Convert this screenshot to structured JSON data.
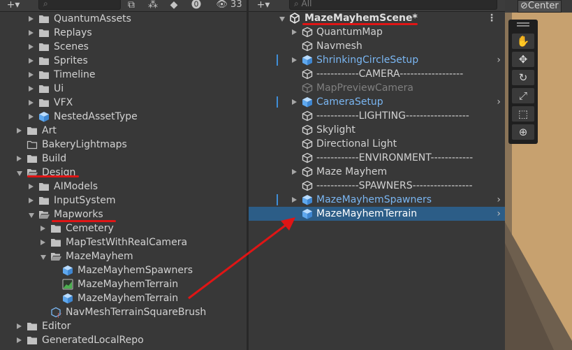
{
  "project": {
    "search_placeholder": "",
    "badge_count": "33",
    "items": [
      {
        "label": "QuantumAssets",
        "icon": "folder",
        "expand": "right",
        "indent": 1
      },
      {
        "label": "Replays",
        "icon": "folder",
        "expand": "right",
        "indent": 1
      },
      {
        "label": "Scenes",
        "icon": "folder",
        "expand": "right",
        "indent": 1
      },
      {
        "label": "Sprites",
        "icon": "folder",
        "expand": "right",
        "indent": 1
      },
      {
        "label": "Timeline",
        "icon": "folder",
        "expand": "right",
        "indent": 1
      },
      {
        "label": "Ui",
        "icon": "folder",
        "expand": "right",
        "indent": 1
      },
      {
        "label": "VFX",
        "icon": "folder",
        "expand": "right",
        "indent": 1
      },
      {
        "label": "NestedAssetType",
        "icon": "prefab",
        "expand": "right",
        "indent": 1
      },
      {
        "label": "Art",
        "icon": "folder",
        "expand": "right",
        "indent": 0
      },
      {
        "label": "BakeryLightmaps",
        "icon": "folder-empty",
        "expand": "none",
        "indent": 0
      },
      {
        "label": "Build",
        "icon": "folder",
        "expand": "right",
        "indent": 0
      },
      {
        "label": "Design",
        "icon": "folder-open",
        "expand": "down",
        "indent": 0
      },
      {
        "label": "AIModels",
        "icon": "folder",
        "expand": "right",
        "indent": 1
      },
      {
        "label": "InputSystem",
        "icon": "folder",
        "expand": "right",
        "indent": 1
      },
      {
        "label": "Mapworks",
        "icon": "folder-open",
        "expand": "down",
        "indent": 1
      },
      {
        "label": "Cemetery",
        "icon": "folder",
        "expand": "right",
        "indent": 2
      },
      {
        "label": "MapTestWithRealCamera",
        "icon": "folder",
        "expand": "right",
        "indent": 2
      },
      {
        "label": "MazeMayhem",
        "icon": "folder-open",
        "expand": "down",
        "indent": 2
      },
      {
        "label": "MazeMayhemSpawners",
        "icon": "prefab",
        "expand": "none",
        "indent": 3
      },
      {
        "label": "MazeMayhemTerrain",
        "icon": "terrain",
        "expand": "none",
        "indent": 3
      },
      {
        "label": "MazeMayhemTerrain",
        "icon": "prefab",
        "expand": "none",
        "indent": 3
      },
      {
        "label": "NavMeshTerrainSquareBrush",
        "icon": "script-asset",
        "expand": "none",
        "indent": 2
      },
      {
        "label": "Editor",
        "icon": "folder",
        "expand": "right",
        "indent": 0
      },
      {
        "label": "GeneratedLocalRepo",
        "icon": "folder",
        "expand": "right",
        "indent": 0
      }
    ]
  },
  "hierarchy": {
    "search_placeholder": "All",
    "scene_name": "MazeMayhemScene*",
    "items": [
      {
        "label": "QuantumMap",
        "icon": "gameobject",
        "expand": "right",
        "style": "normal",
        "chevron": false,
        "prefab_bar": false
      },
      {
        "label": "Navmesh",
        "icon": "gameobject",
        "expand": "none",
        "style": "normal",
        "chevron": false,
        "prefab_bar": false
      },
      {
        "label": "ShrinkingCircleSetup",
        "icon": "prefab",
        "expand": "right",
        "style": "blue",
        "chevron": true,
        "prefab_bar": true
      },
      {
        "label": "------------CAMERA------------------",
        "icon": "gameobject",
        "expand": "none",
        "style": "normal",
        "chevron": false,
        "prefab_bar": false
      },
      {
        "label": "MapPreviewCamera",
        "icon": "gameobject-dim",
        "expand": "none",
        "style": "dim",
        "chevron": false,
        "prefab_bar": false
      },
      {
        "label": "CameraSetup",
        "icon": "prefab",
        "expand": "right",
        "style": "blue",
        "chevron": true,
        "prefab_bar": true
      },
      {
        "label": "------------LIGHTING------------------",
        "icon": "gameobject",
        "expand": "none",
        "style": "normal",
        "chevron": false,
        "prefab_bar": false
      },
      {
        "label": "Skylight",
        "icon": "gameobject",
        "expand": "none",
        "style": "normal",
        "chevron": false,
        "prefab_bar": false
      },
      {
        "label": "Directional Light",
        "icon": "gameobject",
        "expand": "none",
        "style": "normal",
        "chevron": false,
        "prefab_bar": false
      },
      {
        "label": "------------ENVIRONMENT------------",
        "icon": "gameobject",
        "expand": "none",
        "style": "normal",
        "chevron": false,
        "prefab_bar": false
      },
      {
        "label": "Maze Mayhem",
        "icon": "gameobject",
        "expand": "right",
        "style": "normal",
        "chevron": false,
        "prefab_bar": false
      },
      {
        "label": "------------SPAWNERS-----------------",
        "icon": "gameobject",
        "expand": "none",
        "style": "normal",
        "chevron": false,
        "prefab_bar": false
      },
      {
        "label": "MazeMayhemSpawners",
        "icon": "prefab",
        "expand": "right",
        "style": "blue",
        "chevron": true,
        "prefab_bar": true
      },
      {
        "label": "MazeMayhemTerrain",
        "icon": "prefab",
        "expand": "none",
        "style": "selected",
        "chevron": true,
        "prefab_bar": false
      }
    ]
  },
  "scene": {
    "pivot_label": "Center",
    "tools": [
      "hand-tool-icon",
      "move-tool-icon",
      "rotate-tool-icon",
      "scale-tool-icon",
      "rect-tool-icon",
      "transform-tool-icon"
    ]
  },
  "colors": {
    "annotation_red": "#e01515",
    "selection_blue": "#2c5d87",
    "prefab_blue": "#7ab6f2"
  }
}
